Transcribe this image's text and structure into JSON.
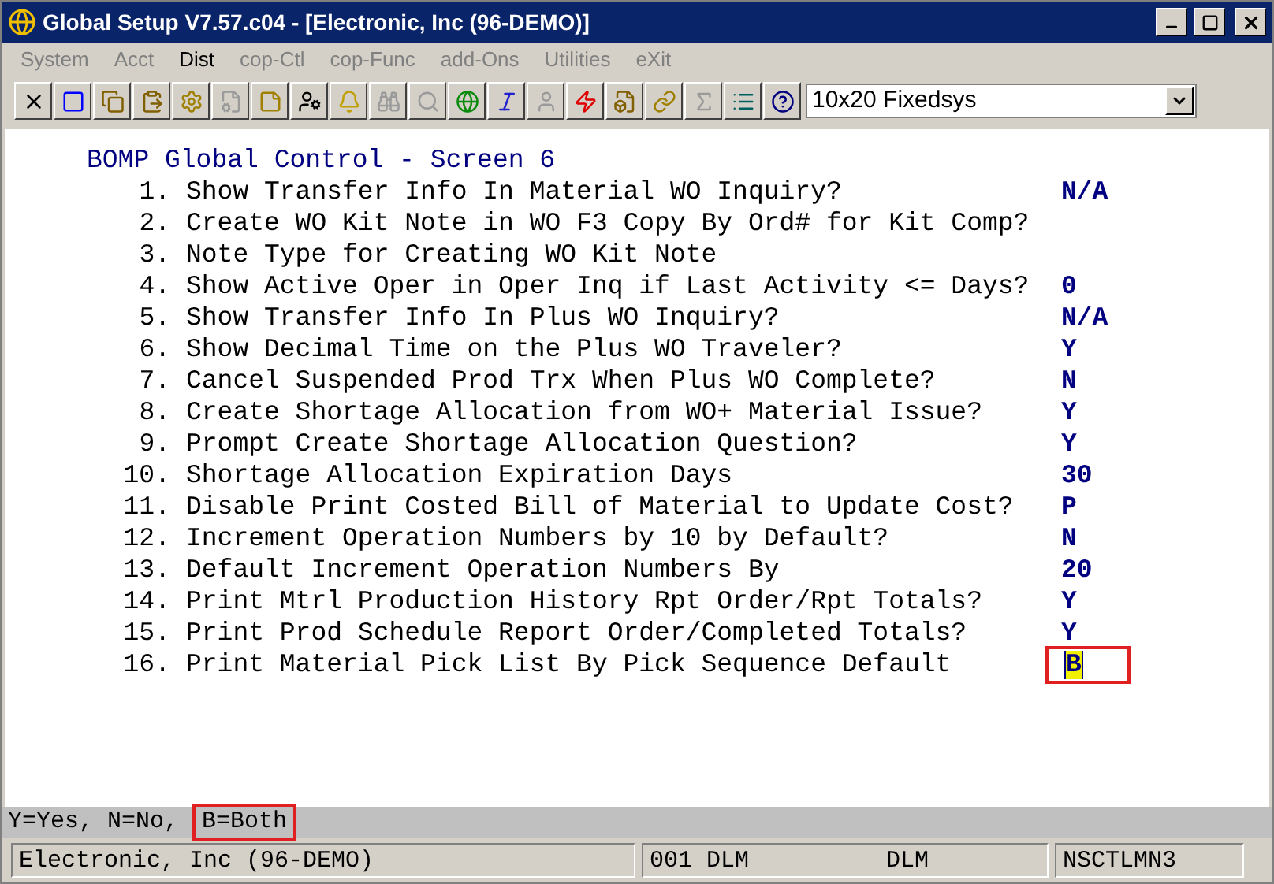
{
  "window": {
    "title": "Global Setup V7.57.c04 - [Electronic, Inc (96-DEMO)]"
  },
  "menu": [
    {
      "label": "System",
      "disabled": true
    },
    {
      "label": "Acct",
      "disabled": true
    },
    {
      "label": "Dist",
      "disabled": false
    },
    {
      "label": "cop-Ctl",
      "disabled": true
    },
    {
      "label": "cop-Func",
      "disabled": true
    },
    {
      "label": "add-Ons",
      "disabled": true
    },
    {
      "label": "Utilities",
      "disabled": true
    },
    {
      "label": "eXit",
      "disabled": true
    }
  ],
  "toolbar": [
    {
      "kind": "close",
      "disabled": false
    },
    {
      "kind": "select",
      "disabled": false
    },
    {
      "kind": "copy",
      "disabled": false
    },
    {
      "kind": "paste",
      "disabled": false
    },
    {
      "kind": "gear",
      "disabled": false
    },
    {
      "kind": "properties",
      "disabled": true
    },
    {
      "kind": "notes",
      "disabled": false
    },
    {
      "kind": "user",
      "disabled": false
    },
    {
      "kind": "bell",
      "disabled": false
    },
    {
      "kind": "binoculars",
      "disabled": true
    },
    {
      "kind": "search",
      "disabled": true
    },
    {
      "kind": "globe",
      "disabled": false
    },
    {
      "kind": "font",
      "disabled": false
    },
    {
      "kind": "person",
      "disabled": true
    },
    {
      "kind": "bolt",
      "disabled": false
    },
    {
      "kind": "bolt-file",
      "disabled": false
    },
    {
      "kind": "link",
      "disabled": false
    },
    {
      "kind": "function",
      "disabled": true
    },
    {
      "kind": "list",
      "disabled": false
    },
    {
      "kind": "help",
      "disabled": false
    }
  ],
  "font_select": {
    "value": "10x20 Fixedsys"
  },
  "screen": {
    "title": "BOMP Global Control - Screen 6",
    "rows": [
      {
        "number": "1.",
        "label": "Show Transfer Info In Material WO Inquiry?",
        "value": "N/A",
        "focused": false
      },
      {
        "number": "2.",
        "label": "Create WO Kit Note in WO F3 Copy By Ord# for Kit Comp?",
        "value": "",
        "focused": false
      },
      {
        "number": "3.",
        "label": "Note Type for Creating WO Kit Note",
        "value": "",
        "focused": false
      },
      {
        "number": "4.",
        "label": "Show Active Oper in Oper Inq if Last Activity <= Days?",
        "value": "0",
        "focused": false
      },
      {
        "number": "5.",
        "label": "Show Transfer Info In Plus WO Inquiry?",
        "value": "N/A",
        "focused": false
      },
      {
        "number": "6.",
        "label": "Show Decimal Time on the Plus WO Traveler?",
        "value": "Y",
        "focused": false
      },
      {
        "number": "7.",
        "label": "Cancel Suspended Prod Trx When Plus WO Complete?",
        "value": "N",
        "focused": false
      },
      {
        "number": "8.",
        "label": "Create Shortage Allocation from WO+ Material Issue?",
        "value": "Y",
        "focused": false
      },
      {
        "number": "9.",
        "label": "Prompt Create Shortage Allocation Question?",
        "value": "Y",
        "focused": false
      },
      {
        "number": "10.",
        "label": "Shortage Allocation Expiration Days",
        "value": "30",
        "focused": false
      },
      {
        "number": "11.",
        "label": "Disable Print Costed Bill of Material to Update Cost?",
        "value": "P",
        "focused": false
      },
      {
        "number": "12.",
        "label": "Increment Operation Numbers by 10 by Default?",
        "value": "N",
        "focused": false
      },
      {
        "number": "13.",
        "label": "Default Increment Operation Numbers By",
        "value": "20",
        "focused": false
      },
      {
        "number": "14.",
        "label": "Print Mtrl Production History Rpt Order/Rpt Totals?",
        "value": "Y",
        "focused": false
      },
      {
        "number": "15.",
        "label": "Print Prod Schedule Report Order/Completed Totals?",
        "value": "Y",
        "focused": false
      },
      {
        "number": "16.",
        "label": "Print Material Pick List By Pick Sequence Default",
        "value": "B",
        "focused": true
      }
    ]
  },
  "hint": [
    {
      "text": "Y=Yes, N=No, ",
      "highlighted": false
    },
    {
      "text": "B=Both",
      "highlighted": true
    }
  ],
  "status_bar": {
    "company": "Electronic, Inc (96-DEMO)",
    "session": "001 DLM",
    "user": "DLM",
    "program": "NSCTLMN3"
  }
}
